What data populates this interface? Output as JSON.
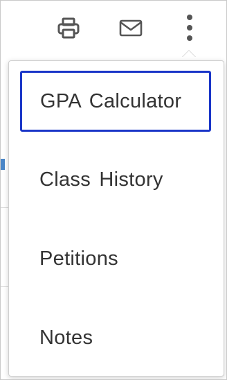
{
  "toolbar": {
    "print": {
      "icon": "printer-icon"
    },
    "mail": {
      "icon": "envelope-icon"
    },
    "more": {
      "icon": "vertical-ellipsis-icon"
    }
  },
  "menu": {
    "items": [
      {
        "label": "GPA Calculator",
        "focused": true
      },
      {
        "label": "Class History",
        "focused": false
      },
      {
        "label": "Petitions",
        "focused": false
      },
      {
        "label": "Notes",
        "focused": false
      }
    ]
  },
  "colors": {
    "icon": "#555555",
    "text": "#333333",
    "focus_ring": "#1a36c8",
    "menu_border": "#cfcfcf"
  }
}
